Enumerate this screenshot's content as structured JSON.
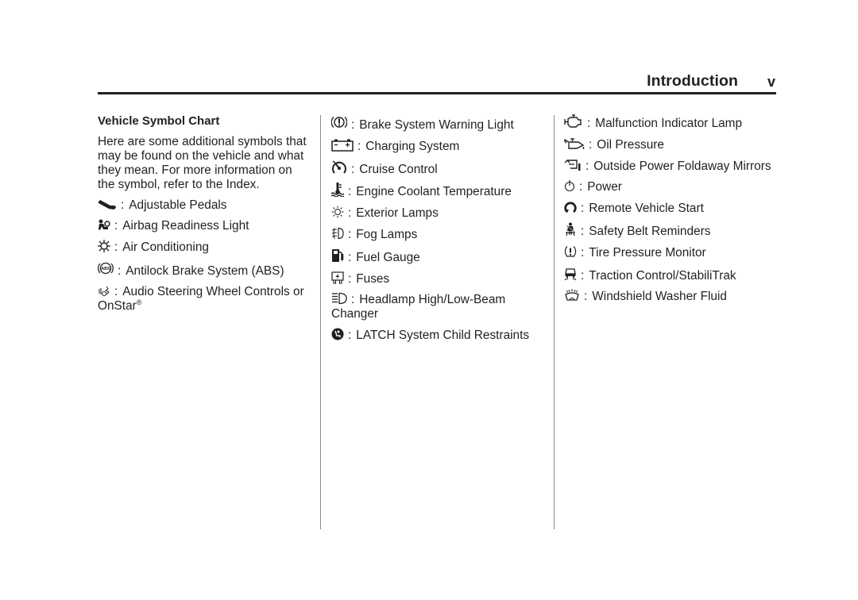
{
  "header": {
    "title": "Introduction",
    "page_number": "v"
  },
  "section": {
    "title": "Vehicle Symbol Chart",
    "intro": "Here are some additional symbols that may be found on the vehicle and what they mean. For more information on the symbol, refer to the Index."
  },
  "columns": [
    {
      "items": [
        {
          "icon": "adjustable-pedals-icon",
          "label": "Adjustable Pedals"
        },
        {
          "icon": "airbag-icon",
          "label": "Airbag Readiness Light"
        },
        {
          "icon": "air-conditioning-icon",
          "label": "Air Conditioning"
        },
        {
          "icon": "abs-icon",
          "label": "Antilock Brake System (ABS)"
        },
        {
          "icon": "audio-steering-wheel-icon",
          "label": "Audio Steering Wheel Controls or OnStar",
          "suffix": "®"
        }
      ]
    },
    {
      "items": [
        {
          "icon": "brake-warning-icon",
          "label": "Brake System Warning Light"
        },
        {
          "icon": "battery-icon",
          "label": "Charging System"
        },
        {
          "icon": "cruise-control-icon",
          "label": "Cruise Control"
        },
        {
          "icon": "coolant-temperature-icon",
          "label": "Engine Coolant Temperature"
        },
        {
          "icon": "exterior-lamps-icon",
          "label": "Exterior Lamps"
        },
        {
          "icon": "fog-lamps-icon",
          "label": "Fog Lamps"
        },
        {
          "icon": "fuel-pump-icon",
          "label": "Fuel Gauge"
        },
        {
          "icon": "fuse-icon",
          "label": "Fuses"
        },
        {
          "icon": "headlamp-icon",
          "label": "Headlamp High/Low-Beam Changer"
        },
        {
          "icon": "latch-child-seat-icon",
          "label": "LATCH System Child Restraints"
        }
      ]
    },
    {
      "items": [
        {
          "icon": "check-engine-icon",
          "label": "Malfunction Indicator Lamp"
        },
        {
          "icon": "oil-can-icon",
          "label": "Oil Pressure"
        },
        {
          "icon": "mirror-fold-icon",
          "label": "Outside Power Foldaway Mirrors"
        },
        {
          "icon": "power-icon",
          "label": "Power"
        },
        {
          "icon": "remote-start-icon",
          "label": "Remote Vehicle Start"
        },
        {
          "icon": "safety-belt-icon",
          "label": "Safety Belt Reminders"
        },
        {
          "icon": "tire-pressure-icon",
          "label": "Tire Pressure Monitor"
        },
        {
          "icon": "traction-control-icon",
          "label": "Traction Control/StabiliTrak"
        },
        {
          "icon": "washer-fluid-icon",
          "label": "Windshield Washer Fluid"
        }
      ]
    }
  ],
  "separator": ":"
}
